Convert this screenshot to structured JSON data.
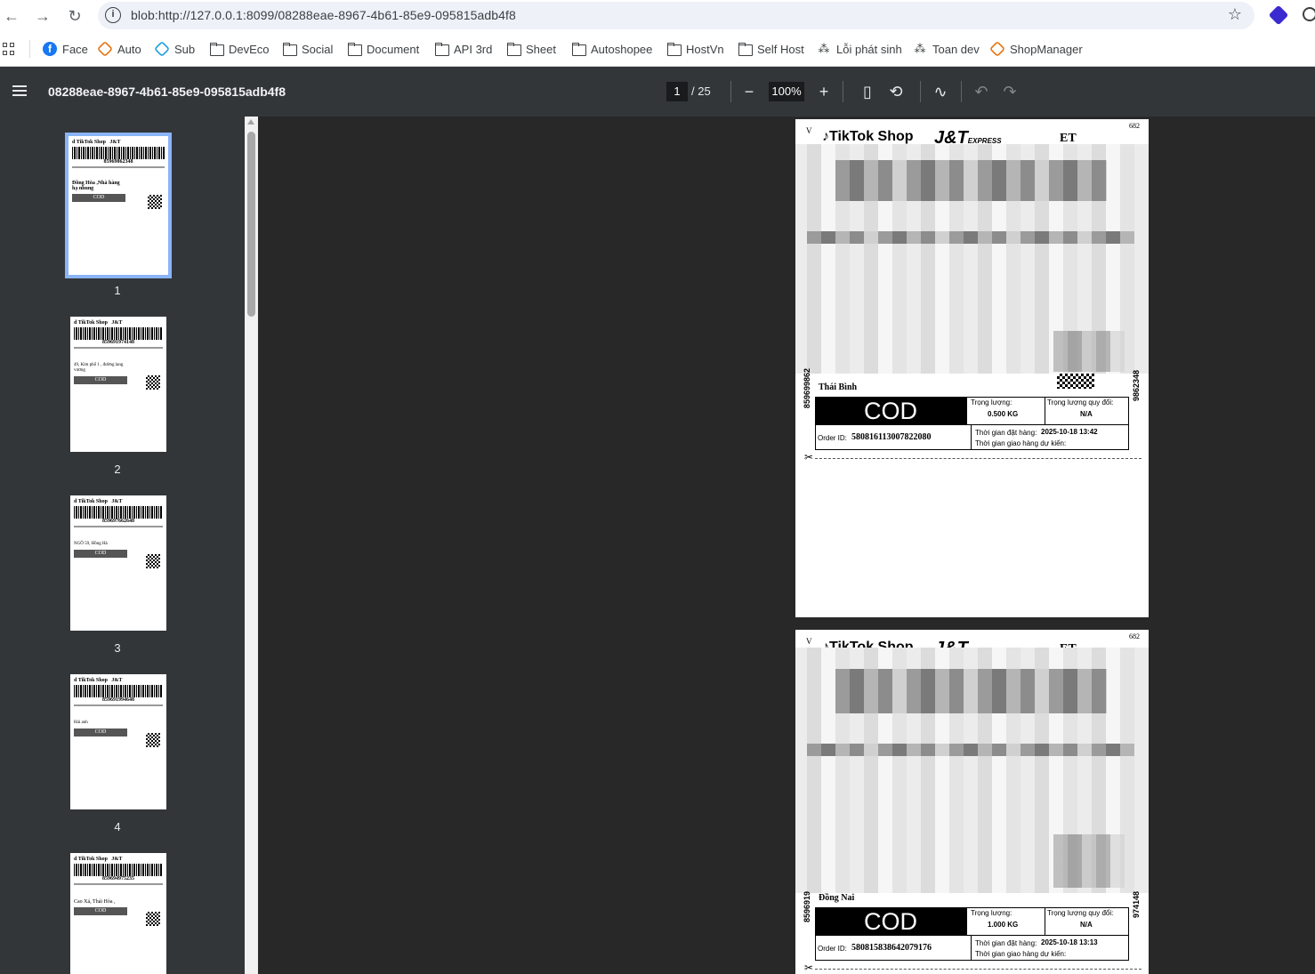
{
  "browser": {
    "url": "blob:http://127.0.0.1:8099/08288eae-8967-4b61-85e9-095815adb4f8",
    "bookmarks": [
      {
        "label": "Face",
        "icon": "facebook-icon"
      },
      {
        "label": "Auto",
        "icon": "hexagon-icon"
      },
      {
        "label": "Sub",
        "icon": "hexagon-icon"
      },
      {
        "label": "DevEco",
        "icon": "folder-icon"
      },
      {
        "label": "Social",
        "icon": "folder-icon"
      },
      {
        "label": "Document",
        "icon": "folder-icon"
      },
      {
        "label": "API 3rd",
        "icon": "folder-icon"
      },
      {
        "label": "Sheet",
        "icon": "folder-icon"
      },
      {
        "label": "Autoshopee",
        "icon": "folder-icon"
      },
      {
        "label": "HostVn",
        "icon": "folder-icon"
      },
      {
        "label": "Self Host",
        "icon": "folder-icon"
      },
      {
        "label": "Lỗi phát sinh",
        "icon": "puzzle-icon"
      },
      {
        "label": "Toan dev",
        "icon": "puzzle-icon"
      },
      {
        "label": "ShopManager",
        "icon": "hexagon-icon"
      }
    ]
  },
  "viewer": {
    "title": "08288eae-8967-4b61-85e9-095815adb4f8",
    "page_current": "1",
    "page_total": "/ 25",
    "zoom": "100%"
  },
  "thumbnails": [
    {
      "num": "1",
      "tracking": "8596986234­8",
      "city": "Đồng Hòa ,Nhà hàng hạ nhung",
      "cod": "COD"
    },
    {
      "num": "2",
      "tracking": "859691974148",
      "city": "49, Kim phố 1 , đường lang vương",
      "cod": "COD"
    },
    {
      "num": "3",
      "tracking": "859697662648",
      "city": "NGÕ 59, Hồng Hà",
      "cod": "COD"
    },
    {
      "num": "4",
      "tracking": "859691994648",
      "city": "Hải anh",
      "cod": "COD"
    },
    {
      "num": "5",
      "tracking": "859694975235",
      "city": "Cao Xá, Thái Hòa ,",
      "cod": "COD"
    }
  ],
  "labels": [
    {
      "brand_tiktok": "TikTok Shop",
      "brand_jt": "J&T",
      "brand_express": "EXPRESS",
      "corner_v": "V",
      "code_et": "ET",
      "code_682": "682",
      "side_left": "859699862",
      "side_right": "9862348",
      "province": "Thái Bình",
      "cod": "COD",
      "weight_label": "Trọng lượng:",
      "weight": "0.500 KG",
      "weight_conv_label": "Trọng lượng quy đổi:",
      "weight_conv": "N/A",
      "order_label": "Order ID:",
      "order_id": "580816113007822080",
      "order_time_label": "Thời gian đặt hàng:",
      "order_time": "2025-10-18 13:42",
      "delivery_label": "Thời gian giao hàng dự kiến:"
    },
    {
      "brand_tiktok": "TikTok Shop",
      "brand_jt": "J&T",
      "brand_express": "",
      "corner_v": "V",
      "code_et": "ET",
      "code_682": "682",
      "side_left": "8596919",
      "side_right": "974148",
      "province": "Đồng Nai",
      "cod": "COD",
      "weight_label": "Trọng lượng:",
      "weight": "1.000 KG",
      "weight_conv_label": "Trọng lượng quy đổi:",
      "weight_conv": "N/A",
      "order_label": "Order ID:",
      "order_id": "580815838642079176",
      "order_time_label": "Thời gian đặt hàng:",
      "order_time": "2025-10-18 13:13",
      "delivery_label": "Thời gian giao hàng dự kiến:"
    }
  ]
}
